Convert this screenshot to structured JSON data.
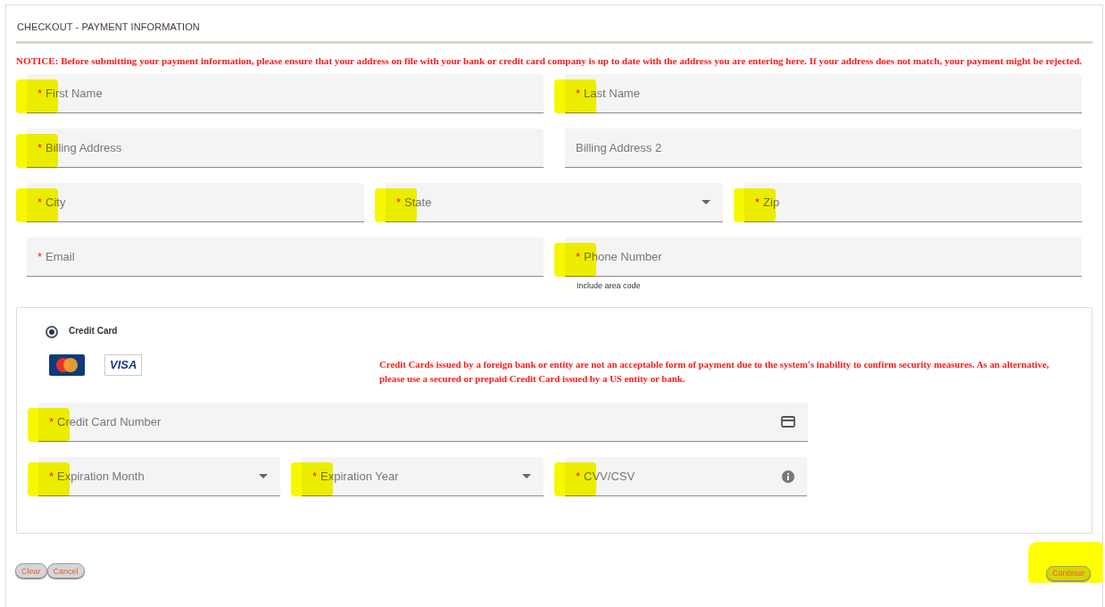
{
  "title": "CHECKOUT - PAYMENT INFORMATION",
  "notice": "NOTICE: Before submitting your payment information, please ensure that your address on file with your bank or credit card company is up to date with the address you are entering here. If your address does not match, your payment might be rejected.",
  "required_mark": "*",
  "address_rows": [
    [
      {
        "kind": "text",
        "placeholder": "First Name",
        "required": true,
        "highlighted": true
      },
      {
        "kind": "text",
        "placeholder": "Last Name",
        "required": true,
        "highlighted": true
      }
    ],
    [
      {
        "kind": "text",
        "placeholder": "Billing Address",
        "required": true,
        "highlighted": true
      },
      {
        "kind": "text",
        "placeholder": "Billing Address 2",
        "required": false,
        "highlighted": false
      }
    ],
    [
      {
        "kind": "text",
        "placeholder": "City",
        "required": true,
        "highlighted": true
      },
      {
        "kind": "select",
        "placeholder": "State",
        "required": true,
        "highlighted": true
      },
      {
        "kind": "text",
        "placeholder": "Zip",
        "required": true,
        "highlighted": true
      }
    ],
    [
      {
        "kind": "text",
        "placeholder": "Email",
        "required": true,
        "highlighted": false
      },
      {
        "kind": "text",
        "placeholder": "Phone Number",
        "required": true,
        "highlighted": true,
        "helper": "Include area code"
      }
    ]
  ],
  "payment": {
    "option": {
      "label": "Credit Card",
      "selected": true
    },
    "logos": [
      {
        "kind": "mastercard"
      },
      {
        "kind": "visa",
        "text": "VISA"
      }
    ],
    "warning": "Credit Cards issued by a foreign bank or entity are not an acceptable form of payment due to the system's inability to confirm security measures. As an alternative, please use a secured or prepaid Credit Card issued by a US entity or bank.",
    "rows": [
      [
        {
          "kind": "card",
          "placeholder": "Credit Card Number",
          "required": true,
          "highlighted": true
        }
      ],
      [
        {
          "kind": "select",
          "placeholder": "Expiration Month",
          "required": true,
          "highlighted": true
        },
        {
          "kind": "select",
          "placeholder": "Expiration Year",
          "required": true,
          "highlighted": true
        },
        {
          "kind": "info",
          "placeholder": "CVV/CSV",
          "required": true,
          "highlighted": true
        }
      ]
    ]
  },
  "buttons": [
    {
      "label": "Clear",
      "highlighted": false
    },
    {
      "label": "Cancel",
      "highlighted": false
    }
  ],
  "continue_button": {
    "label": "Continue",
    "highlighted": true
  }
}
